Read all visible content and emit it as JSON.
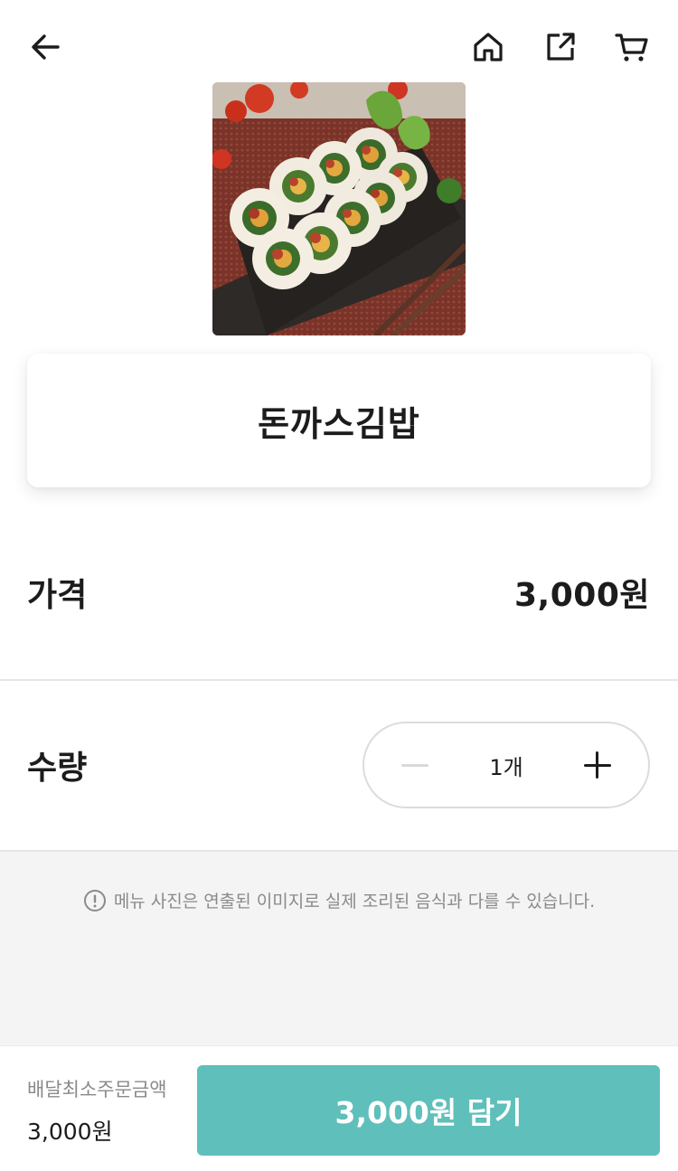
{
  "header": {
    "back_icon": "arrow-left-icon",
    "home_icon": "home-icon",
    "share_icon": "share-icon",
    "cart_icon": "cart-icon"
  },
  "product": {
    "image": "kimbap-photo",
    "name": "돈까스김밥"
  },
  "price": {
    "label": "가격",
    "value": "3,000원"
  },
  "quantity": {
    "label": "수량",
    "value": "1개",
    "minus_icon": "minus-icon",
    "plus_icon": "plus-icon"
  },
  "notice": {
    "icon": "exclamation-circle-icon",
    "text": "메뉴 사진은 연출된 이미지로 실제 조리된 음식과 다를 수 있습니다."
  },
  "footer": {
    "min_order_label": "배달최소주문금액",
    "min_order_value": "3,000원",
    "add_button_label": "3,000원 담기"
  },
  "colors": {
    "accent": "#5fbfbb",
    "text": "#1c1c1c",
    "muted": "#8a8a8a",
    "panel": "#f4f4f4"
  }
}
